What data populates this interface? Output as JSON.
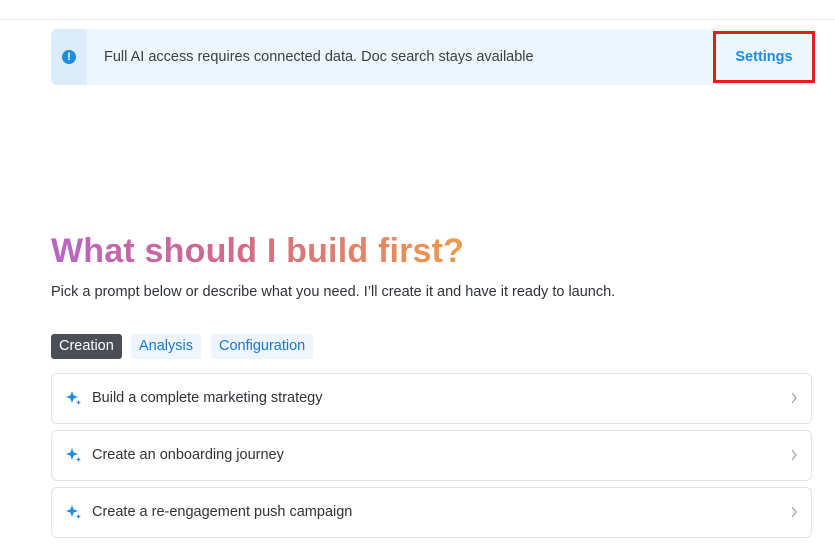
{
  "banner": {
    "icon": "exclamation-circle-icon",
    "message": "Full AI access requires connected data. Doc search stays available",
    "settings_label": "Settings",
    "accent_color": "#1c8de0",
    "highlight_color": "#e0201c"
  },
  "main": {
    "heading": "What should I build first?",
    "subheading": "Pick a prompt below or describe what you need. I’ll create it and have it ready to launch.",
    "tabs": [
      {
        "label": "Creation",
        "active": true
      },
      {
        "label": "Analysis",
        "active": false
      },
      {
        "label": "Configuration",
        "active": false
      }
    ],
    "prompts": [
      {
        "label": "Build a complete marketing strategy",
        "icon": "sparkle-icon"
      },
      {
        "label": "Create an onboarding journey",
        "icon": "sparkle-icon"
      },
      {
        "label": "Create a re-engagement push campaign",
        "icon": "sparkle-icon"
      }
    ]
  }
}
